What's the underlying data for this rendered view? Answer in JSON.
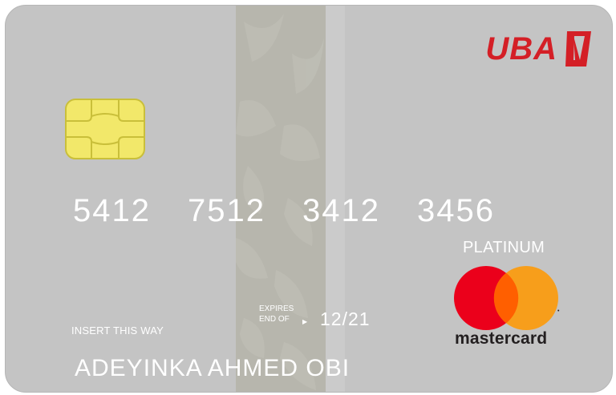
{
  "card": {
    "bank_logo_text": "UBA",
    "brand_color": "#d41f26",
    "card_number": [
      "5412",
      "7512",
      "3412",
      "3456"
    ],
    "insert_hint": "INSERT THIS WAY",
    "expires_label_line1": "EXPIRES",
    "expires_label_line2": "END OF",
    "expiry_date": "12/21",
    "cardholder_name": "ADEYINKA AHMED OBI",
    "tier": "PLATINUM",
    "network_name": "mastercard",
    "network_colors": {
      "red": "#eb001b",
      "orange": "#f79e1b",
      "overlap": "#ff5f00"
    },
    "card_color": "#c4c4c4",
    "chip_color": "#f2e86a"
  }
}
